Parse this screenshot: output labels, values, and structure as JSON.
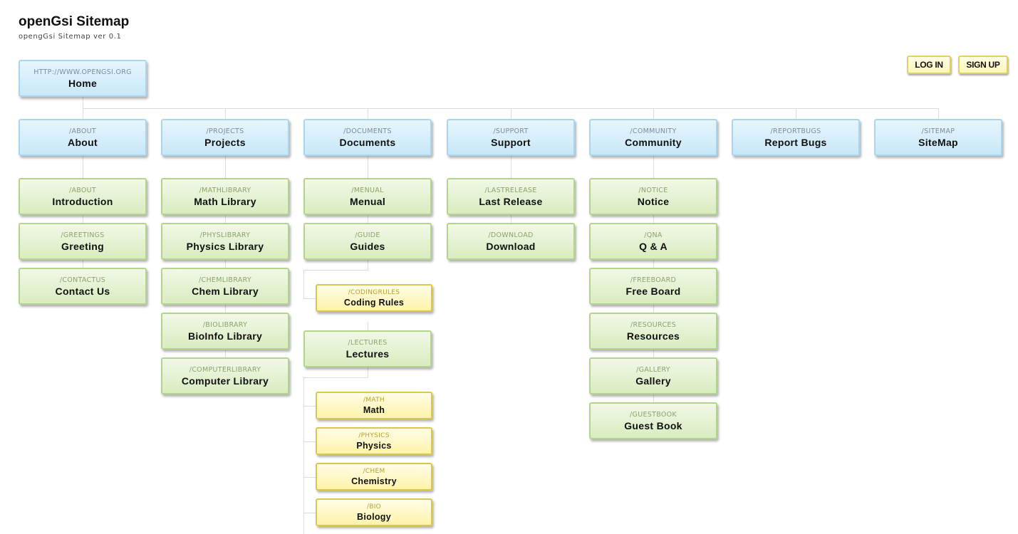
{
  "header": {
    "title": "openGsi Sitemap",
    "subtitle": "opengGsi Sitemap ver 0.1"
  },
  "auth": {
    "login_label": "LOG IN",
    "signup_label": "SIGN UP"
  },
  "colors": {
    "level0_level1": "#c8e8f8",
    "level2": "#d9ecbf",
    "level3": "#fff3a8",
    "connector": "#dcdcdc"
  },
  "sitemap": {
    "root": {
      "path": "HTTP://WWW.OPENGSI.ORG",
      "label": "Home"
    },
    "sections": [
      {
        "path": "/ABOUT",
        "label": "About",
        "children": [
          {
            "path": "/ABOUT",
            "label": "Introduction"
          },
          {
            "path": "/GREETINGS",
            "label": "Greeting"
          },
          {
            "path": "/CONTACTUS",
            "label": "Contact Us"
          }
        ]
      },
      {
        "path": "/PROJECTS",
        "label": "Projects",
        "children": [
          {
            "path": "/MATHLIBRARY",
            "label": "Math Library"
          },
          {
            "path": "/PHYSLIBRARY",
            "label": "Physics Library"
          },
          {
            "path": "/CHEMLIBRARY",
            "label": "Chem Library"
          },
          {
            "path": "/BIOLIBRARY",
            "label": "BioInfo Library"
          },
          {
            "path": "/COMPUTERLIBRARY",
            "label": "Computer Library"
          }
        ]
      },
      {
        "path": "/DOCUMENTS",
        "label": "Documents",
        "children": [
          {
            "path": "/MENUAL",
            "label": "Menual"
          },
          {
            "path": "/GUIDE",
            "label": "Guides",
            "children": [
              {
                "path": "/CODINGRULES",
                "label": "Coding Rules"
              }
            ]
          },
          {
            "path": "/LECTURES",
            "label": "Lectures",
            "children": [
              {
                "path": "/MATH",
                "label": "Math"
              },
              {
                "path": "/PHYSICS",
                "label": "Physics"
              },
              {
                "path": "/CHEM",
                "label": "Chemistry"
              },
              {
                "path": "/BIO",
                "label": "Biology"
              }
            ]
          }
        ]
      },
      {
        "path": "/SUPPORT",
        "label": "Support",
        "children": [
          {
            "path": "/LASTRELEASE",
            "label": "Last Release"
          },
          {
            "path": "/DOWNLOAD",
            "label": "Download"
          }
        ]
      },
      {
        "path": "/COMMUNITY",
        "label": "Community",
        "children": [
          {
            "path": "/NOTICE",
            "label": "Notice"
          },
          {
            "path": "/QNA",
            "label": "Q & A"
          },
          {
            "path": "/FREEBOARD",
            "label": "Free Board"
          },
          {
            "path": "/RESOURCES",
            "label": "Resources"
          },
          {
            "path": "/GALLERY",
            "label": "Gallery"
          },
          {
            "path": "/GUESTBOOK",
            "label": "Guest Book"
          }
        ]
      },
      {
        "path": "/REPORTBUGS",
        "label": "Report Bugs",
        "children": []
      },
      {
        "path": "/SITEMAP",
        "label": "SiteMap",
        "children": []
      }
    ]
  }
}
